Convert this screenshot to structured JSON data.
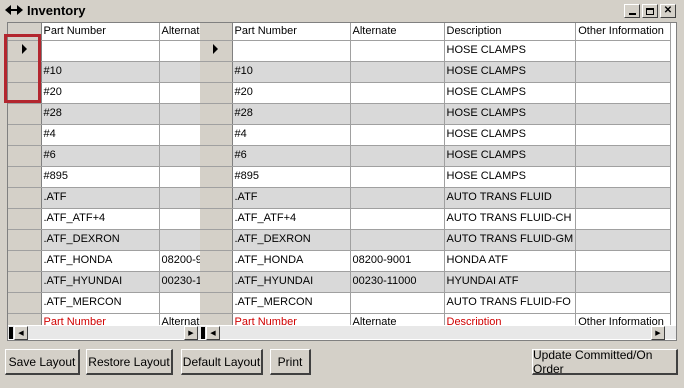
{
  "window": {
    "title": "Inventory"
  },
  "left_grid": {
    "headers": [
      "Part Number",
      "Alternate"
    ],
    "footer": [
      "Part Number",
      "Alternate"
    ],
    "rows": [
      [
        "",
        ""
      ],
      [
        "#10",
        ""
      ],
      [
        "#20",
        ""
      ],
      [
        "#28",
        ""
      ],
      [
        "#4",
        ""
      ],
      [
        "#6",
        ""
      ],
      [
        "#895",
        ""
      ],
      [
        ".ATF",
        ""
      ],
      [
        ".ATF_ATF+4",
        ""
      ],
      [
        ".ATF_DEXRON",
        ""
      ],
      [
        ".ATF_HONDA",
        "08200-9"
      ],
      [
        ".ATF_HYUNDAI",
        "00230-1"
      ],
      [
        ".ATF_MERCON",
        ""
      ]
    ]
  },
  "right_grid": {
    "headers": [
      "Part Number",
      "Alternate",
      "Description",
      "Other Information"
    ],
    "footer": [
      "Part Number",
      "Alternate",
      "Description",
      "Other Information"
    ],
    "rows": [
      [
        "",
        "",
        "HOSE CLAMPS",
        ""
      ],
      [
        "#10",
        "",
        "HOSE CLAMPS",
        ""
      ],
      [
        "#20",
        "",
        "HOSE CLAMPS",
        ""
      ],
      [
        "#28",
        "",
        "HOSE CLAMPS",
        ""
      ],
      [
        "#4",
        "",
        "HOSE CLAMPS",
        ""
      ],
      [
        "#6",
        "",
        "HOSE CLAMPS",
        ""
      ],
      [
        "#895",
        "",
        "HOSE CLAMPS",
        ""
      ],
      [
        ".ATF",
        "",
        "AUTO TRANS FLUID",
        ""
      ],
      [
        ".ATF_ATF+4",
        "",
        "AUTO TRANS FLUID-CH",
        ""
      ],
      [
        ".ATF_DEXRON",
        "",
        "AUTO TRANS FLUID-GM",
        ""
      ],
      [
        ".ATF_HONDA",
        "08200-9001",
        "HONDA ATF",
        ""
      ],
      [
        ".ATF_HYUNDAI",
        "00230-11000",
        "HYUNDAI ATF",
        ""
      ],
      [
        ".ATF_MERCON",
        "",
        "AUTO TRANS FLUID-FO",
        ""
      ]
    ]
  },
  "buttons": {
    "save_layout": "Save Layout",
    "restore_layout": "Restore Layout",
    "default_layout": "Default Layout",
    "print": "Print",
    "update_committed": "Update Committed/On Order"
  },
  "icons": {
    "title_icon": "double-arrow-icon",
    "minimize": "minimize-icon",
    "restore": "restore-icon",
    "close": "close-icon",
    "row_pointer": "row-pointer-icon"
  }
}
